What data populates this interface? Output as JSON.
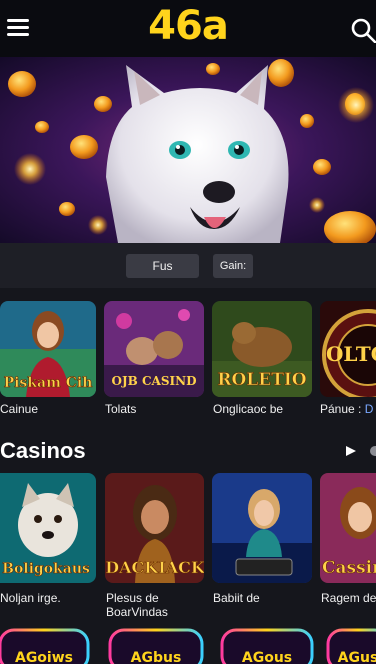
{
  "header": {
    "logo": "46a",
    "menu_icon": "hamburger-icon",
    "search_icon": "search-icon"
  },
  "tabs": [
    {
      "label": "Fus"
    },
    {
      "label": "Gain:"
    }
  ],
  "featured": {
    "cards": [
      {
        "art_text": "Piskam Cih",
        "caption": "Cainue"
      },
      {
        "art_text": "OJB CASIND",
        "caption": "Tolats"
      },
      {
        "art_text": "ROLETIO",
        "caption": "Onglicaoc be"
      },
      {
        "art_text": "OLTO",
        "caption_a": "Pánue :",
        "caption_b": "D"
      }
    ]
  },
  "casinos": {
    "title": "Casinos",
    "cards": [
      {
        "art_text": "Boligokaus",
        "caption": "Noljan irge."
      },
      {
        "art_text": "DACKIACK",
        "caption_line1": "Plesus de",
        "caption_line2": "BoarVindas"
      },
      {
        "art_text": "",
        "caption": "Babiit de"
      },
      {
        "art_text": "Cassin",
        "caption": "Ragem de"
      }
    ]
  },
  "bottom_banners": [
    {
      "label": "AGoiws"
    },
    {
      "label": "AGbus"
    },
    {
      "label": "AGous"
    },
    {
      "label": "AGus"
    }
  ],
  "colors": {
    "accent": "#ffd41c",
    "background": "#15161c",
    "header": "#0a0b10"
  }
}
